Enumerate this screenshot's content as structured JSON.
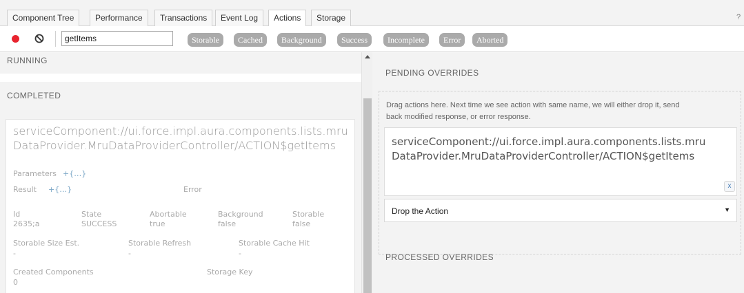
{
  "tabs": [
    {
      "label": "Component Tree",
      "active": false
    },
    {
      "label": "Performance",
      "active": false
    },
    {
      "label": "Transactions",
      "active": false
    },
    {
      "label": "Event Log",
      "active": false
    },
    {
      "label": "Actions",
      "active": true
    },
    {
      "label": "Storage",
      "active": false
    }
  ],
  "help_label": "?",
  "toolbar": {
    "filter_value": "getItems",
    "filters": [
      "Storable",
      "Cached",
      "Background",
      "Success",
      "Incomplete",
      "Error",
      "Aborted"
    ],
    "record_color": "#e8242f"
  },
  "left": {
    "running_label": "RUNNING",
    "completed_label": "COMPLETED",
    "action": {
      "name": "serviceComponent://ui.force.impl.aura.components.lists.mruDataProvider.MruDataProviderController/ACTION$getItems",
      "name_line1": "serviceComponent://ui.force.impl.aura.components.lists.mru",
      "name_line2": "DataProvider.MruDataProviderController/ACTION$getItems",
      "parameters_label": "Parameters",
      "parameters_value": "+{…}",
      "result_label": "Result",
      "result_value": "+{…}",
      "error_label": "Error",
      "id_label": "Id",
      "id_value": "2635;a",
      "state_label": "State",
      "state_value": "SUCCESS",
      "abortable_label": "Abortable",
      "abortable_value": "true",
      "background_label": "Background",
      "background_value": "false",
      "storable_label": "Storable",
      "storable_value": "false",
      "size_label": "Storable Size Est.",
      "size_value": "-",
      "refresh_label": "Storable Refresh",
      "refresh_value": "-",
      "cache_hit_label": "Storable Cache Hit",
      "cache_hit_value": "-",
      "created_label": "Created Components",
      "created_value": "0",
      "storage_key_label": "Storage Key"
    }
  },
  "right": {
    "pending_label": "PENDING OVERRIDES",
    "drop_hint_line1": "Drag actions here. Next time we see action with same name, we will either drop it, send",
    "drop_hint_line2": "back modified response, or error response.",
    "override_line1": "serviceComponent://ui.force.impl.aura.components.lists.mru",
    "override_line2": "DataProvider.MruDataProviderController/ACTION$getItems",
    "remove_label": "x",
    "select_value": "Drop the Action",
    "processed_label": "PROCESSED OVERRIDES"
  }
}
